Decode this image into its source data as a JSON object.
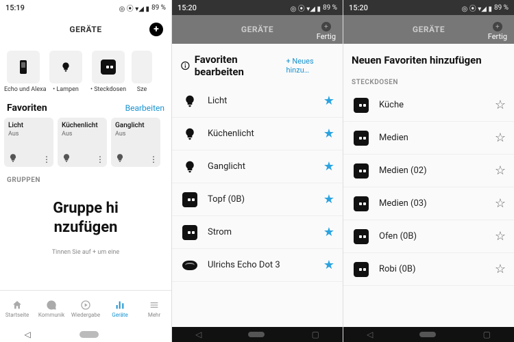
{
  "status": {
    "time1": "15:19",
    "time2": "15:20",
    "battery": "89 %"
  },
  "header": {
    "title": "GERÄTE",
    "fertig": "Fertig"
  },
  "s1": {
    "categories": [
      {
        "label": "Echo und Alexa"
      },
      {
        "label": "• Lampen"
      },
      {
        "label": "• Steckdosen"
      },
      {
        "label": "Sze"
      }
    ],
    "favorites_title": "Favoriten",
    "edit": "Bearbeiten",
    "tiles": [
      {
        "name": "Licht",
        "state": "Aus"
      },
      {
        "name": "Küchenlicht",
        "state": "Aus"
      },
      {
        "name": "Ganglicht",
        "state": "Aus"
      }
    ],
    "groups_label": "GRUPPEN",
    "add_group": "Gruppe hi\nnzufügen",
    "hint": "Tinnen Sie auf +  um eine",
    "nav": {
      "home": "Startseite",
      "comm": "Kommunik",
      "play": "Wiedergabe",
      "devices": "Geräte",
      "more": "Mehr"
    }
  },
  "s2": {
    "title": "Favoriten bearbeiten",
    "add_new": "+ Neues hinzu…",
    "rows": [
      {
        "name": "Licht",
        "icon": "bulb"
      },
      {
        "name": "Küchenlicht",
        "icon": "bulb"
      },
      {
        "name": "Ganglicht",
        "icon": "bulb"
      },
      {
        "name": "Topf (0B)",
        "icon": "plug"
      },
      {
        "name": "Strom",
        "icon": "plug"
      },
      {
        "name": "Ulrichs Echo Dot 3",
        "icon": "echo"
      }
    ]
  },
  "s3": {
    "title": "Neuen Favoriten hinzufügen",
    "section": "STECKDOSEN",
    "rows": [
      {
        "name": "Küche"
      },
      {
        "name": "Medien"
      },
      {
        "name": "Medien (02)"
      },
      {
        "name": "Medien (03)"
      },
      {
        "name": "Ofen (0B)"
      },
      {
        "name": "Robi (0B)"
      }
    ]
  }
}
